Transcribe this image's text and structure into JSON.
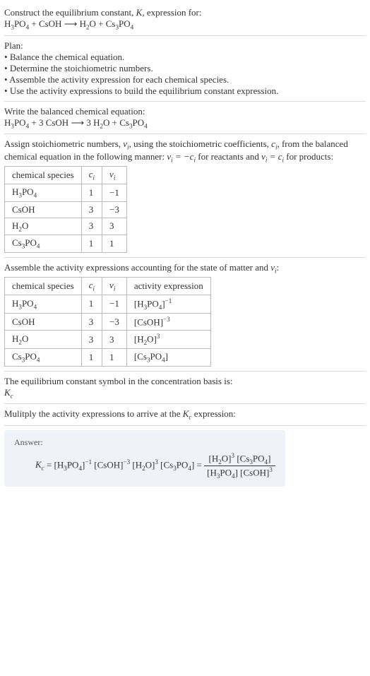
{
  "intro": {
    "line1": "Construct the equilibrium constant, ",
    "Kital": "K",
    "line1b": ", expression for:",
    "equation": "H₃PO₄ + CsOH ⟶ H₂O + Cs₃PO₄"
  },
  "plan": {
    "title": "Plan:",
    "items": [
      "Balance the chemical equation.",
      "Determine the stoichiometric numbers.",
      "Assemble the activity expression for each chemical species.",
      "Use the activity expressions to build the equilibrium constant expression."
    ]
  },
  "balanced": {
    "title": "Write the balanced chemical equation:",
    "equation": "H₃PO₄ + 3 CsOH ⟶ 3 H₂O + Cs₃PO₄"
  },
  "stoich": {
    "intro_a": "Assign stoichiometric numbers, ",
    "nu": "ν",
    "sub_i": "i",
    "intro_b": ", using the stoichiometric coefficients, ",
    "c": "c",
    "intro_c": ", from the balanced chemical equation in the following manner: ",
    "rel_reactants": "νᵢ = −cᵢ",
    "intro_d": " for reactants and ",
    "rel_products": "νᵢ = cᵢ",
    "intro_e": " for products:",
    "headers": {
      "species": "chemical species",
      "ci": "cᵢ",
      "nui": "νᵢ"
    },
    "rows": [
      {
        "species": "H₃PO₄",
        "ci": "1",
        "nui": "−1"
      },
      {
        "species": "CsOH",
        "ci": "3",
        "nui": "−3"
      },
      {
        "species": "H₂O",
        "ci": "3",
        "nui": "3"
      },
      {
        "species": "Cs₃PO₄",
        "ci": "1",
        "nui": "1"
      }
    ]
  },
  "activity": {
    "intro": "Assemble the activity expressions accounting for the state of matter and νᵢ:",
    "headers": {
      "species": "chemical species",
      "ci": "cᵢ",
      "nui": "νᵢ",
      "act": "activity expression"
    },
    "rows": [
      {
        "species": "H₃PO₄",
        "ci": "1",
        "nui": "−1",
        "act": "[H₃PO₄]⁻¹"
      },
      {
        "species": "CsOH",
        "ci": "3",
        "nui": "−3",
        "act": "[CsOH]⁻³"
      },
      {
        "species": "H₂O",
        "ci": "3",
        "nui": "3",
        "act": "[H₂O]³"
      },
      {
        "species": "Cs₃PO₄",
        "ci": "1",
        "nui": "1",
        "act": "[Cs₃PO₄]"
      }
    ]
  },
  "symbol": {
    "intro": "The equilibrium constant symbol in the concentration basis is:",
    "Kc": "K_c"
  },
  "multiply": {
    "intro_a": "Mulitply the activity expressions to arrive at the ",
    "Kc": "K_c",
    "intro_b": " expression:"
  },
  "answer": {
    "label": "Answer:",
    "lhs": "K_c = [H₃PO₄]⁻¹ [CsOH]⁻³ [H₂O]³ [Cs₃PO₄] = ",
    "num": "[H₂O]³ [Cs₃PO₄]",
    "den": "[H₃PO₄] [CsOH]³"
  },
  "chart_data": {
    "type": "table",
    "tables": [
      {
        "title": "stoichiometric numbers",
        "columns": [
          "chemical species",
          "c_i",
          "ν_i"
        ],
        "rows": [
          [
            "H3PO4",
            1,
            -1
          ],
          [
            "CsOH",
            3,
            -3
          ],
          [
            "H2O",
            3,
            3
          ],
          [
            "Cs3PO4",
            1,
            1
          ]
        ]
      },
      {
        "title": "activity expressions",
        "columns": [
          "chemical species",
          "c_i",
          "ν_i",
          "activity expression"
        ],
        "rows": [
          [
            "H3PO4",
            1,
            -1,
            "[H3PO4]^-1"
          ],
          [
            "CsOH",
            3,
            -3,
            "[CsOH]^-3"
          ],
          [
            "H2O",
            3,
            3,
            "[H2O]^3"
          ],
          [
            "Cs3PO4",
            1,
            1,
            "[Cs3PO4]"
          ]
        ]
      }
    ]
  }
}
